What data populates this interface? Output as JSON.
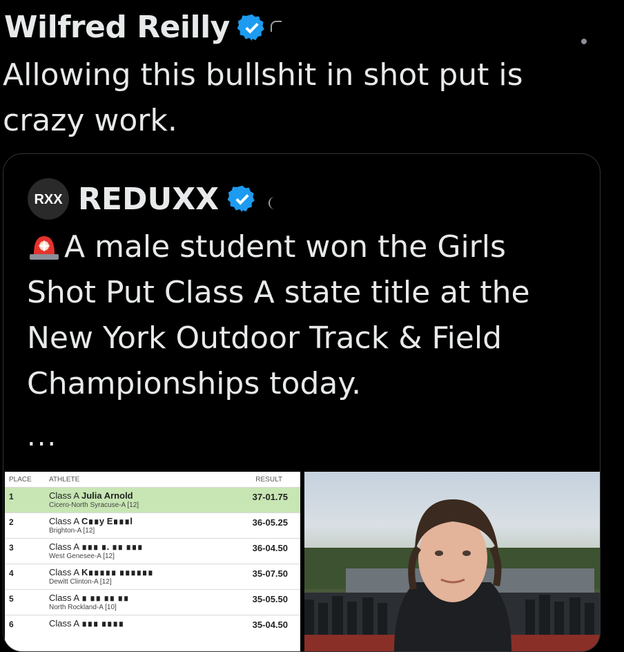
{
  "tweet": {
    "author_name": "Wilfred Reilly",
    "text": "Allowing this bullshit in shot put is crazy work."
  },
  "quoted": {
    "author_name": "REDUXX",
    "avatar_text": "RXX",
    "text": "A male student won the Girls Shot Put Class A state title at the New York Outdoor Track & Field Championships today.",
    "ellipsis": "...",
    "results": {
      "headers": {
        "place": "PLACE",
        "athlete": "ATHLETE",
        "result": "RESULT"
      },
      "rows": [
        {
          "place": "1",
          "class": "Class A",
          "name": "Julia Arnold",
          "school": "Cicero-North Syracuse-A [12]",
          "result": "37-01.75"
        },
        {
          "place": "2",
          "class": "Class A",
          "name": "C∎∎y E∎∎∎l",
          "school": "Brighton-A [12]",
          "result": "36-05.25"
        },
        {
          "place": "3",
          "class": "Class A",
          "name": "∎∎∎ ∎. ∎∎ ∎∎∎",
          "school": "West Genesee-A [12]",
          "result": "36-04.50"
        },
        {
          "place": "4",
          "class": "Class A",
          "name": "K∎∎∎∎∎ ∎∎∎∎∎∎",
          "school": "Dewitt Clinton-A [12]",
          "result": "35-07.50"
        },
        {
          "place": "5",
          "class": "Class A",
          "name": "∎ ∎∎ ∎∎ ∎∎",
          "school": "North Rockland-A [10]",
          "result": "35-05.50"
        },
        {
          "place": "6",
          "class": "Class A",
          "name": "∎∎∎ ∎∎∎∎",
          "school": "",
          "result": "35-04.50"
        }
      ]
    }
  },
  "colors": {
    "verified": "#1d9bf0",
    "winner_row": "#c8e6b4",
    "background": "#000000",
    "text": "#e7e9ea"
  }
}
